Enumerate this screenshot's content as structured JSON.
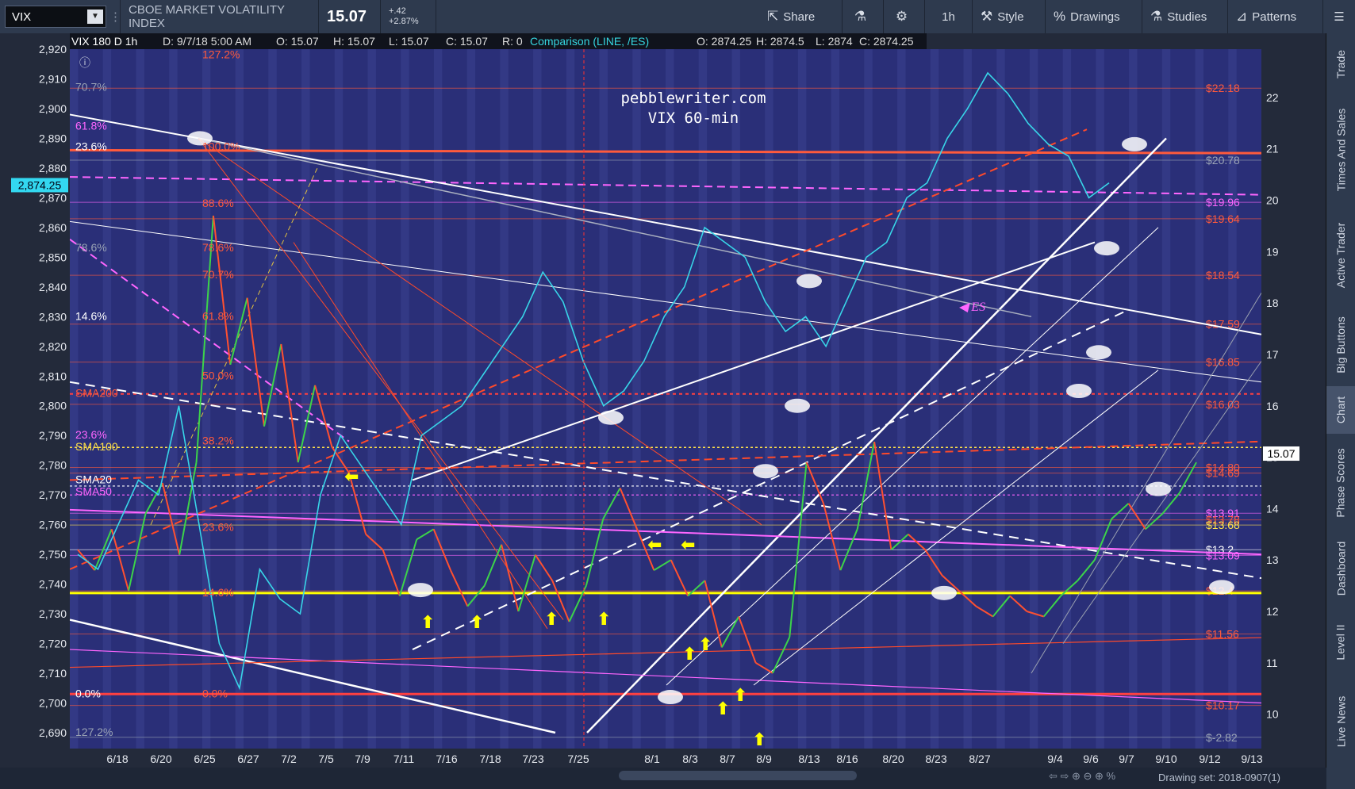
{
  "toolbar": {
    "symbol": "VIX",
    "index_name": "CBOE MARKET VOLATILITY INDEX",
    "last_price": "15.07",
    "change": "+.42",
    "change_pct": "+2.87%",
    "share": "Share",
    "interval": "1h",
    "style": "Style",
    "drawings": "Drawings",
    "studies": "Studies",
    "patterns": "Patterns"
  },
  "rail": [
    "Trade",
    "Times And Sales",
    "Active Trader",
    "Big Buttons",
    "Chart",
    "Phase Scores",
    "Dashboard",
    "Level II",
    "Live News"
  ],
  "bottom": {
    "drawing_set": "Drawing set: 2018-0907(1)"
  },
  "chart_data": {
    "type": "line",
    "header": {
      "study": "VIX 180 D 1h",
      "date": "D: 9/7/18 5:00 AM",
      "o": "O: 15.07",
      "h": "H: 15.07",
      "l": "L: 15.07",
      "c": "C: 15.07",
      "r": "R: 0",
      "comparison": "Comparison (LINE, /ES)",
      "co": "O: 2874.25",
      "ch": "H: 2874.5",
      "cl": "L: 2874",
      "cc": "C: 2874.25"
    },
    "watermark": [
      "pebblewriter.com",
      "VIX 60-min"
    ],
    "x_ticks": [
      "6/18",
      "6/20",
      "6/25",
      "6/27",
      "7/2",
      "7/5",
      "7/9",
      "7/11",
      "7/16",
      "7/18",
      "7/23",
      "7/25",
      "8/1",
      "8/3",
      "8/7",
      "8/9",
      "8/13",
      "8/16",
      "8/20",
      "8/23",
      "8/27",
      "9/4",
      "9/6",
      "9/7",
      "9/10",
      "9/12",
      "9/13"
    ],
    "left_axis": {
      "min": 2690,
      "max": 2920,
      "ticks": [
        "2,920",
        "2,910",
        "2,900",
        "2,890",
        "2,880",
        "2,870",
        "2,860",
        "2,850",
        "2,840",
        "2,830",
        "2,820",
        "2,810",
        "2,800",
        "2,790",
        "2,780",
        "2,770",
        "2,760",
        "2,750",
        "2,740",
        "2,730",
        "2,720",
        "2,710",
        "2,700",
        "2,690"
      ],
      "label_value": "2,874.25"
    },
    "right_axis": {
      "min": 10,
      "max": 22,
      "ticks": [
        "22",
        "21",
        "20",
        "19",
        "18",
        "17",
        "16",
        "15",
        "14",
        "13",
        "12",
        "11",
        "10"
      ],
      "label_value": "15.07"
    },
    "right_labels": [
      {
        "text": "$22.18",
        "v": 22.18,
        "color": "#ff5a3c"
      },
      {
        "text": "$20.78",
        "v": 20.78,
        "color": "#9aa3b5"
      },
      {
        "text": "$19.96",
        "v": 19.96,
        "color": "#ff66ff"
      },
      {
        "text": "$19.64",
        "v": 19.64,
        "color": "#ff5a3c"
      },
      {
        "text": "$18.54",
        "v": 18.54,
        "color": "#ff5a3c"
      },
      {
        "text": "$17.59",
        "v": 17.59,
        "color": "#ff5a3c"
      },
      {
        "text": "$16.85",
        "v": 16.85,
        "color": "#ff5a3c"
      },
      {
        "text": "$16.03",
        "v": 16.03,
        "color": "#ff5a3c"
      },
      {
        "text": "$14.80",
        "v": 14.8,
        "color": "#ff5a3c"
      },
      {
        "text": "$14.69",
        "v": 14.69,
        "color": "#ff5a3c"
      },
      {
        "text": "$13.91",
        "v": 13.91,
        "color": "#ff66ff"
      },
      {
        "text": "$13.78",
        "v": 13.78,
        "color": "#ff5a3c"
      },
      {
        "text": "$13.68",
        "v": 13.68,
        "color": "#ffe14a"
      },
      {
        "text": "$13.2",
        "v": 13.2,
        "color": "#ffffff"
      },
      {
        "text": "$13.09",
        "v": 13.09,
        "color": "#ff66ff"
      },
      {
        "text": "$12.4",
        "v": 12.4,
        "color": "#ff5a3c"
      },
      {
        "text": "$11.56",
        "v": 11.56,
        "color": "#ff5a3c"
      },
      {
        "text": "$10.17",
        "v": 10.17,
        "color": "#ff5a3c"
      },
      {
        "text": "$-2.82",
        "v": 9.55,
        "color": "#9aa3b5"
      }
    ],
    "left_fibs": [
      {
        "text": "70.7%",
        "v": 2907,
        "color": "#9aa3b5"
      },
      {
        "text": "61.8%",
        "v": 2894,
        "color": "#ff66ff"
      },
      {
        "text": "23.6%",
        "v": 2887,
        "color": "#ffffff"
      },
      {
        "text": "78.6%",
        "v": 2853,
        "color": "#9aa3b5"
      },
      {
        "text": "14.6%",
        "v": 2830,
        "color": "#ffffff"
      },
      {
        "text": "23.6%",
        "v": 2790,
        "color": "#ff66ff"
      },
      {
        "text": "0.0%",
        "v": 2703,
        "color": "#ffffff"
      },
      {
        "text": "127.2%",
        "v": 2690,
        "color": "#9aa3b5"
      }
    ],
    "mid_fibs": [
      {
        "text": "127.2%",
        "v": 2918
      },
      {
        "text": "100.0%",
        "v": 2887
      },
      {
        "text": "88.6%",
        "v": 2868
      },
      {
        "text": "78.6%",
        "v": 2853
      },
      {
        "text": "70.7%",
        "v": 2844
      },
      {
        "text": "61.8%",
        "v": 2830
      },
      {
        "text": "50.0%",
        "v": 2810
      },
      {
        "text": "38.2%",
        "v": 2788
      },
      {
        "text": "23.6%",
        "v": 2759
      },
      {
        "text": "14.6%",
        "v": 2737
      },
      {
        "text": "0.0%",
        "v": 2703
      }
    ],
    "sma_labels": [
      {
        "text": "SMA200",
        "v": 2804,
        "color": "#ff5a3c"
      },
      {
        "text": "SMA100",
        "v": 2786,
        "color": "#ffe14a"
      },
      {
        "text": "SMA20",
        "v": 2775,
        "color": "#ffffff"
      },
      {
        "text": "SMA50",
        "v": 2771,
        "color": "#ff66ff"
      }
    ],
    "es_label": "ES",
    "series": [
      {
        "name": "VIX",
        "values": [
          13.2,
          12.8,
          13.6,
          12.4,
          13.9,
          14.5,
          13.1,
          14.9,
          19.7,
          16.8,
          18.1,
          15.6,
          17.2,
          14.9,
          16.4,
          15.2,
          14.7,
          13.5,
          13.2,
          12.3,
          13.4,
          13.6,
          12.8,
          12.1,
          12.5,
          13.3,
          12.0,
          13.1,
          12.6,
          11.8,
          12.5,
          13.8,
          14.4,
          13.6,
          12.8,
          13.0,
          12.3,
          12.6,
          11.3,
          11.9,
          11.0,
          10.8,
          11.5,
          14.9,
          14.1,
          12.8,
          13.6,
          15.3,
          13.2,
          13.5,
          13.2,
          12.7,
          12.4,
          12.1,
          11.9,
          12.3,
          12.0,
          11.9,
          12.3,
          12.6,
          13.0,
          13.8,
          14.1,
          13.6,
          13.9,
          14.3,
          14.9
        ]
      },
      {
        "name": "/ES",
        "values": [
          2750,
          2745,
          2760,
          2775,
          2770,
          2800,
          2760,
          2720,
          2705,
          2745,
          2735,
          2730,
          2770,
          2790,
          2780,
          2770,
          2760,
          2790,
          2795,
          2800,
          2810,
          2820,
          2830,
          2845,
          2835,
          2815,
          2800,
          2805,
          2815,
          2830,
          2840,
          2860,
          2855,
          2850,
          2835,
          2825,
          2830,
          2820,
          2835,
          2850,
          2855,
          2870,
          2875,
          2890,
          2900,
          2912,
          2905,
          2895,
          2888,
          2884,
          2870,
          2875
        ]
      }
    ]
  }
}
